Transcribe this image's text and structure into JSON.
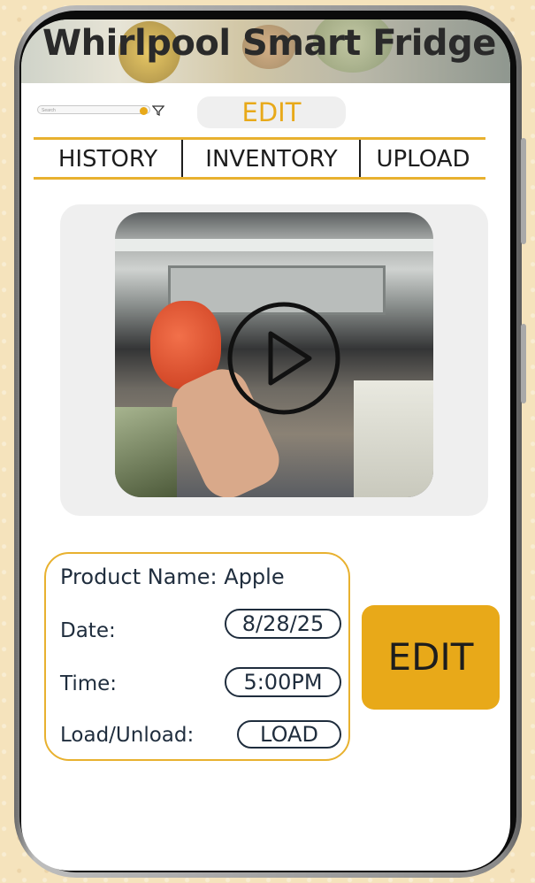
{
  "app": {
    "title": "Whirlpool Smart Fridge"
  },
  "toolbar": {
    "search_placeholder": "Search",
    "edit_tab": "EDIT"
  },
  "nav": {
    "items": [
      "HISTORY",
      "INVENTORY",
      "UPLOAD"
    ]
  },
  "video": {
    "state": "paused",
    "icon": "play-icon"
  },
  "details": {
    "product_label": "Product Name: Apple",
    "date_label": "Date:",
    "date_value": "8/28/25",
    "time_label": "Time:",
    "time_value": "5:00PM",
    "load_label": "Load/Unload:",
    "load_value": "LOAD"
  },
  "actions": {
    "edit_button": "EDIT"
  },
  "colors": {
    "accent": "#e8a919",
    "border": "#e8b12f",
    "text": "#1f2d3d"
  }
}
